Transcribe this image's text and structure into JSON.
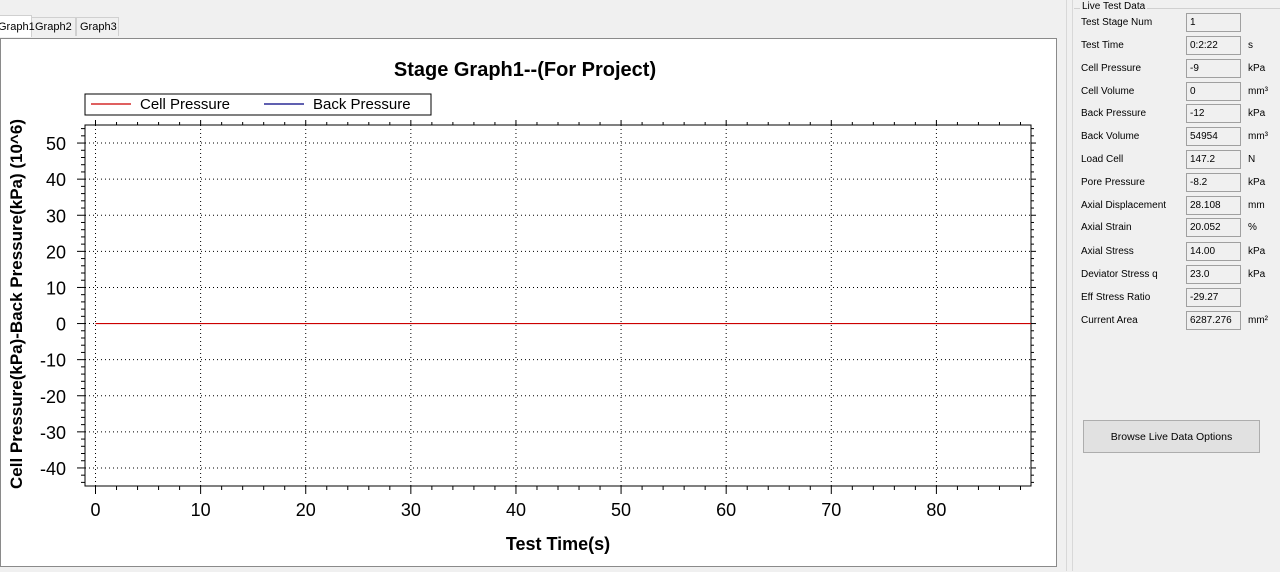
{
  "tabs": [
    {
      "label": "Graph1",
      "active": true
    },
    {
      "label": "Graph2",
      "active": false
    },
    {
      "label": "Graph3",
      "active": false
    }
  ],
  "chart_data": {
    "type": "line",
    "title": "Stage Graph1--(For Project)",
    "xlabel": "Test Time(s)",
    "ylabel": "Cell Pressure(kPa)-Back Pressure(kPa) (10^6)",
    "xlim": [
      -1,
      89
    ],
    "ylim": [
      -45,
      55
    ],
    "xticks": [
      0,
      10,
      20,
      30,
      40,
      50,
      60,
      70,
      80
    ],
    "yticks": [
      50,
      40,
      30,
      20,
      10,
      0,
      -10,
      -20,
      -30,
      -40
    ],
    "grid": true,
    "legend_position": "top-left",
    "series": [
      {
        "name": "Cell Pressure",
        "color": "#cc0000",
        "x": [
          0,
          89
        ],
        "y": [
          0,
          0
        ]
      },
      {
        "name": "Back Pressure",
        "color": "#000080",
        "x": [],
        "y": []
      }
    ]
  },
  "live": {
    "legend": "Live Test Data",
    "rows": [
      {
        "label": "Test Stage Num",
        "value": "1",
        "unit": ""
      },
      {
        "label": "Test Time",
        "value": "0:2:22",
        "unit": "s"
      },
      {
        "label": "Cell Pressure",
        "value": "-9",
        "unit": "kPa"
      },
      {
        "label": "Cell Volume",
        "value": "0",
        "unit": "mm³"
      },
      {
        "label": "Back Pressure",
        "value": "-12",
        "unit": "kPa"
      },
      {
        "label": "Back Volume",
        "value": "54954",
        "unit": "mm³"
      },
      {
        "label": "Load Cell",
        "value": "147.2",
        "unit": "N"
      },
      {
        "label": "Pore Pressure",
        "value": "-8.2",
        "unit": "kPa"
      },
      {
        "label": "Axial Displacement",
        "value": "28.108",
        "unit": "mm"
      },
      {
        "label": "Axial Strain",
        "value": "20.052",
        "unit": "%"
      },
      {
        "label": "Axial Stress",
        "value": "14.00",
        "unit": "kPa"
      },
      {
        "label": "Deviator Stress q",
        "value": "23.0",
        "unit": "kPa"
      },
      {
        "label": "Eff Stress Ratio",
        "value": "-29.27",
        "unit": ""
      },
      {
        "label": "Current Area",
        "value": "6287.276",
        "unit": "mm²"
      }
    ],
    "browse_button": "Browse Live Data Options"
  }
}
